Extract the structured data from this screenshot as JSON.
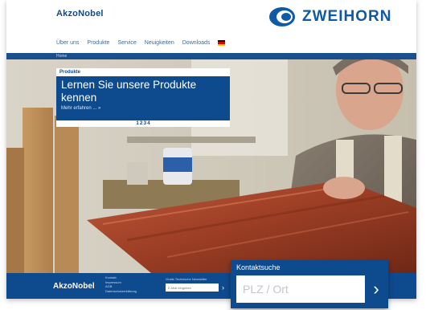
{
  "header": {
    "brand": "AkzoNobel",
    "logo_text": "ZWEIHORN",
    "nav": [
      "Über uns",
      "Produkte",
      "Service",
      "Neuigkeiten",
      "Downloads"
    ],
    "flag": "german-flag-icon",
    "breadcrumb": "Home"
  },
  "promo": {
    "tab": "Produkte",
    "title": "Lernen Sie unsere Produkte kennen",
    "more": "Mehr erfahren ... »",
    "pages": [
      "1",
      "2",
      "3",
      "4"
    ]
  },
  "footer": {
    "brand": "AkzoNobel",
    "links": [
      "Kontakt",
      "Impressum",
      "AGB",
      "Datenschutzerklärung"
    ],
    "newsletter_label": "Gratis Technische Newsletter",
    "newsletter_placeholder": "E-Mail eingeben",
    "newsletter_arrow": "›"
  },
  "contact": {
    "title": "Kontaktsuche",
    "placeholder": "PLZ / Ort",
    "arrow": "›"
  },
  "colors": {
    "brand_blue": "#0e4a8e",
    "logo_blue": "#0f5aa6",
    "wood": "#9a3d24"
  }
}
